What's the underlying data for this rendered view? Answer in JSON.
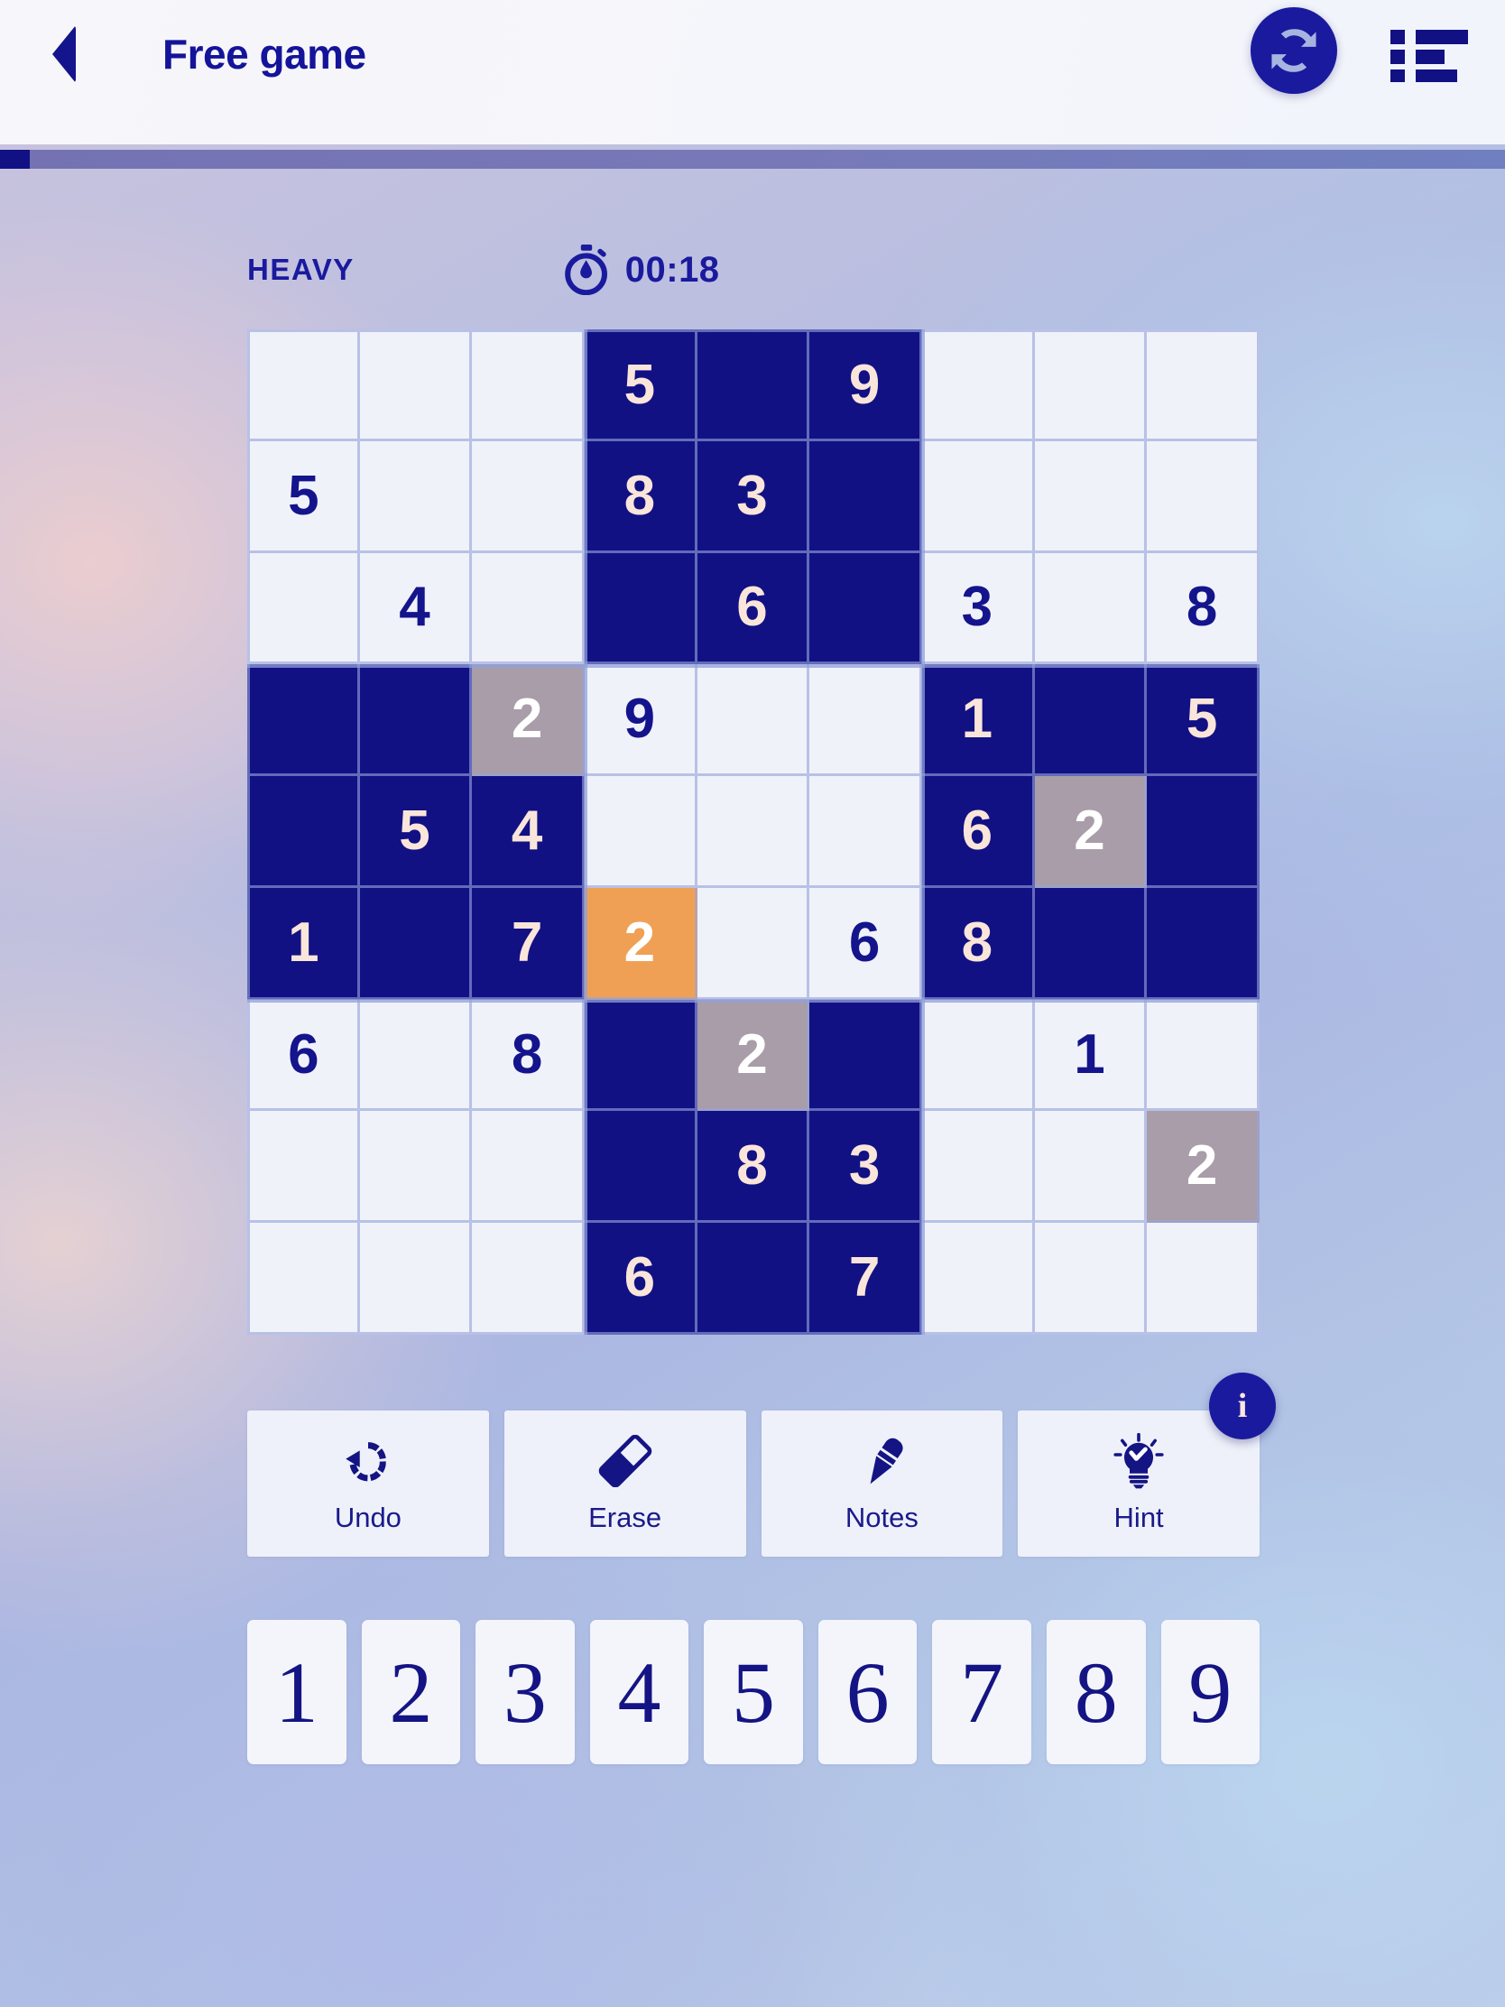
{
  "header": {
    "back_icon": "back-arrow-icon",
    "title": "Free game",
    "refresh_icon": "refresh-icon",
    "menu_icon": "list-menu-icon"
  },
  "progress": {
    "percent": 2
  },
  "meta": {
    "difficulty": "HEAVY",
    "timer_icon": "stopwatch-icon",
    "timer": "00:18"
  },
  "board": {
    "rows": [
      [
        {
          "v": "",
          "s": "normal"
        },
        {
          "v": "",
          "s": "normal"
        },
        {
          "v": "",
          "s": "normal"
        },
        {
          "v": "5",
          "s": "highlight"
        },
        {
          "v": "",
          "s": "highlight"
        },
        {
          "v": "9",
          "s": "highlight"
        },
        {
          "v": "",
          "s": "normal"
        },
        {
          "v": "",
          "s": "normal"
        },
        {
          "v": "",
          "s": "normal"
        }
      ],
      [
        {
          "v": "5",
          "s": "normal"
        },
        {
          "v": "",
          "s": "normal"
        },
        {
          "v": "",
          "s": "normal"
        },
        {
          "v": "8",
          "s": "highlight"
        },
        {
          "v": "3",
          "s": "highlight"
        },
        {
          "v": "",
          "s": "highlight"
        },
        {
          "v": "",
          "s": "normal"
        },
        {
          "v": "",
          "s": "normal"
        },
        {
          "v": "",
          "s": "normal"
        }
      ],
      [
        {
          "v": "",
          "s": "normal"
        },
        {
          "v": "4",
          "s": "normal"
        },
        {
          "v": "",
          "s": "normal"
        },
        {
          "v": "",
          "s": "highlight"
        },
        {
          "v": "6",
          "s": "highlight"
        },
        {
          "v": "",
          "s": "highlight"
        },
        {
          "v": "3",
          "s": "normal"
        },
        {
          "v": "",
          "s": "normal"
        },
        {
          "v": "8",
          "s": "normal"
        }
      ],
      [
        {
          "v": "",
          "s": "highlight"
        },
        {
          "v": "",
          "s": "highlight"
        },
        {
          "v": "2",
          "s": "peer"
        },
        {
          "v": "9",
          "s": "normal"
        },
        {
          "v": "",
          "s": "normal"
        },
        {
          "v": "",
          "s": "normal"
        },
        {
          "v": "1",
          "s": "highlight"
        },
        {
          "v": "",
          "s": "highlight"
        },
        {
          "v": "5",
          "s": "highlight"
        }
      ],
      [
        {
          "v": "",
          "s": "highlight"
        },
        {
          "v": "5",
          "s": "highlight"
        },
        {
          "v": "4",
          "s": "highlight"
        },
        {
          "v": "",
          "s": "normal"
        },
        {
          "v": "",
          "s": "normal"
        },
        {
          "v": "",
          "s": "normal"
        },
        {
          "v": "6",
          "s": "highlight"
        },
        {
          "v": "2",
          "s": "peer"
        },
        {
          "v": "",
          "s": "highlight"
        }
      ],
      [
        {
          "v": "1",
          "s": "highlight"
        },
        {
          "v": "",
          "s": "highlight"
        },
        {
          "v": "7",
          "s": "highlight"
        },
        {
          "v": "2",
          "s": "selected"
        },
        {
          "v": "",
          "s": "normal"
        },
        {
          "v": "6",
          "s": "normal"
        },
        {
          "v": "8",
          "s": "highlight"
        },
        {
          "v": "",
          "s": "highlight"
        },
        {
          "v": "",
          "s": "highlight"
        }
      ],
      [
        {
          "v": "6",
          "s": "normal"
        },
        {
          "v": "",
          "s": "normal"
        },
        {
          "v": "8",
          "s": "normal"
        },
        {
          "v": "",
          "s": "highlight"
        },
        {
          "v": "2",
          "s": "peer"
        },
        {
          "v": "",
          "s": "highlight"
        },
        {
          "v": "",
          "s": "normal"
        },
        {
          "v": "1",
          "s": "normal"
        },
        {
          "v": "",
          "s": "normal"
        }
      ],
      [
        {
          "v": "",
          "s": "normal"
        },
        {
          "v": "",
          "s": "normal"
        },
        {
          "v": "",
          "s": "normal"
        },
        {
          "v": "",
          "s": "highlight"
        },
        {
          "v": "8",
          "s": "highlight"
        },
        {
          "v": "3",
          "s": "highlight"
        },
        {
          "v": "",
          "s": "normal"
        },
        {
          "v": "",
          "s": "normal"
        },
        {
          "v": "2",
          "s": "peer"
        }
      ],
      [
        {
          "v": "",
          "s": "normal"
        },
        {
          "v": "",
          "s": "normal"
        },
        {
          "v": "",
          "s": "normal"
        },
        {
          "v": "6",
          "s": "highlight"
        },
        {
          "v": "",
          "s": "highlight"
        },
        {
          "v": "7",
          "s": "highlight"
        },
        {
          "v": "",
          "s": "normal"
        },
        {
          "v": "",
          "s": "normal"
        },
        {
          "v": "",
          "s": "normal"
        }
      ]
    ]
  },
  "actions": [
    {
      "label": "Undo",
      "icon": "undo-icon"
    },
    {
      "label": "Erase",
      "icon": "eraser-icon"
    },
    {
      "label": "Notes",
      "icon": "pen-icon"
    },
    {
      "label": "Hint",
      "icon": "lightbulb-icon"
    }
  ],
  "info_badge": "i",
  "numpad": [
    "1",
    "2",
    "3",
    "4",
    "5",
    "6",
    "7",
    "8",
    "9"
  ],
  "colors": {
    "primary": "#14148c",
    "highlight_cell": "#111184",
    "peer_cell": "#a89da8",
    "selected_cell": "#f0a055",
    "cell_bg": "#f0f2fa",
    "highlight_text": "#fae5da"
  }
}
